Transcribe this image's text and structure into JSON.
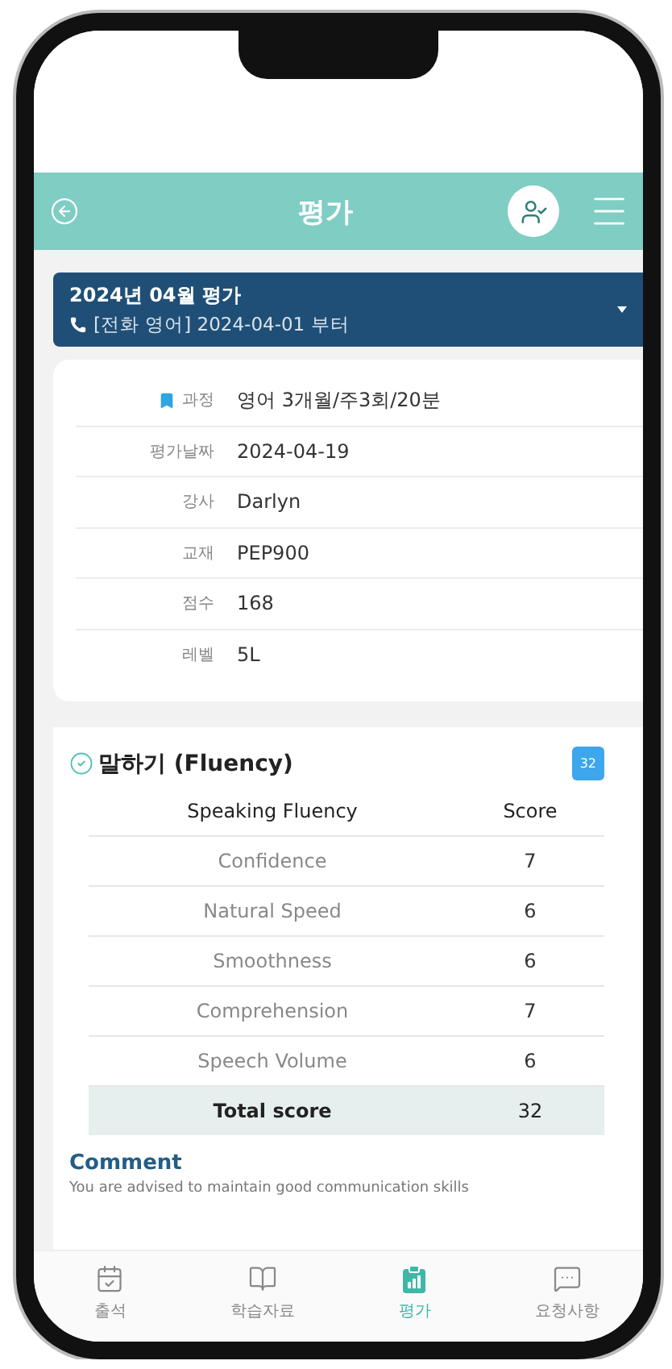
{
  "header": {
    "title": "평가"
  },
  "evaluation_select": {
    "title": "2024년 04월 평가",
    "subtitle": "[전화 영어] 2024-04-01 부터"
  },
  "details": [
    {
      "label": "과정",
      "value": "영어 3개월/주3회/20분",
      "kind": "course"
    },
    {
      "label": "평가날짜",
      "value": "2024-04-19",
      "kind": "plain"
    },
    {
      "label": "강사",
      "value": "Darlyn",
      "kind": "plain"
    },
    {
      "label": "교재",
      "value": "PEP900",
      "kind": "plain"
    },
    {
      "label": "점수",
      "value": "168",
      "kind": "plain"
    },
    {
      "label": "레벨",
      "value": "5L",
      "kind": "plain"
    }
  ],
  "section": {
    "title": "말하기 (Fluency)",
    "badge": "32",
    "columns": [
      "Speaking Fluency",
      "Score"
    ],
    "rows": [
      {
        "item": "Confidence",
        "score": "7"
      },
      {
        "item": "Natural Speed",
        "score": "6"
      },
      {
        "item": "Smoothness",
        "score": "6"
      },
      {
        "item": "Comprehension",
        "score": "7"
      },
      {
        "item": "Speech Volume",
        "score": "6"
      }
    ],
    "total": {
      "label": "Total score",
      "value": "32"
    },
    "comment_title": "Comment",
    "comment": "You are advised to maintain good communication skills"
  },
  "tab_bar": [
    {
      "label": "출석",
      "kind": "attendance",
      "selected": false
    },
    {
      "label": "학습자료",
      "kind": "materials",
      "selected": false
    },
    {
      "label": "평가",
      "kind": "evaluation",
      "selected": true
    },
    {
      "label": "요청사항",
      "kind": "requests",
      "selected": false
    }
  ]
}
